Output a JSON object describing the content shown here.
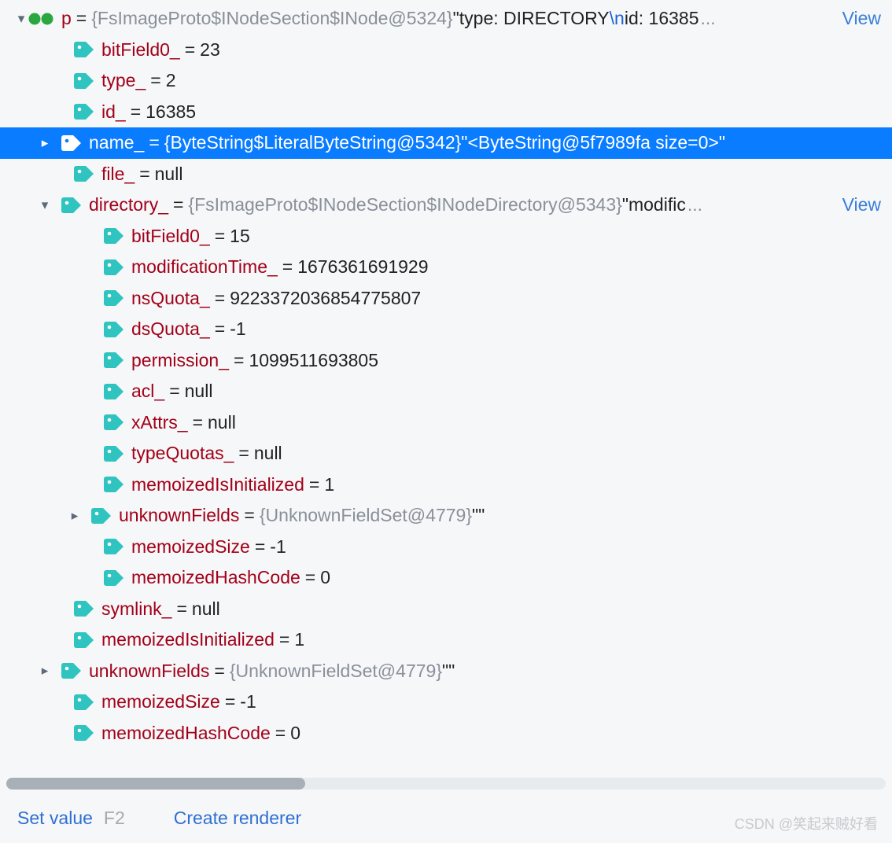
{
  "root": {
    "name": "p",
    "eq": " = ",
    "type": "{FsImageProto$INodeSection$INode@5324}",
    "str1": " \"type: DIRECTORY",
    "nl": "\\n",
    "str2": "id: 16385",
    "view": "View",
    "ell": "..."
  },
  "c": {
    "bf0": {
      "name": "bitField0_",
      "eq": " = ",
      "val": "23"
    },
    "type": {
      "name": "type_",
      "eq": " = ",
      "val": "2"
    },
    "id": {
      "name": "id_",
      "eq": " = ",
      "val": "16385"
    },
    "nameRow": {
      "name": "name_",
      "eq": " = ",
      "type": "{ByteString$LiteralByteString@5342}",
      "str": " \"<ByteString@5f7989fa size=0>\""
    },
    "file": {
      "name": "file_",
      "eq": " = ",
      "val": "null"
    },
    "dir": {
      "name": "directory_",
      "eq": " = ",
      "type": "{FsImageProto$INodeSection$INodeDirectory@5343}",
      "str": " \"modific",
      "ell": "...",
      "view": "View"
    },
    "symlink": {
      "name": "symlink_",
      "eq": " = ",
      "val": "null"
    },
    "mii": {
      "name": "memoizedIsInitialized",
      "eq": " = ",
      "val": "1"
    },
    "uf": {
      "name": "unknownFields",
      "eq": " = ",
      "type": "{UnknownFieldSet@4779}",
      "str": " \"\""
    },
    "msz": {
      "name": "memoizedSize",
      "eq": " = ",
      "val": "-1"
    },
    "mhc": {
      "name": "memoizedHashCode",
      "eq": " = ",
      "val": "0"
    }
  },
  "d": {
    "bf0": {
      "name": "bitField0_",
      "eq": " = ",
      "val": "15"
    },
    "mtime": {
      "name": "modificationTime_",
      "eq": " = ",
      "val": "1676361691929"
    },
    "nsq": {
      "name": "nsQuota_",
      "eq": " = ",
      "val": "9223372036854775807"
    },
    "dsq": {
      "name": "dsQuota_",
      "eq": " = ",
      "val": "-1"
    },
    "perm": {
      "name": "permission_",
      "eq": " = ",
      "val": "1099511693805"
    },
    "acl": {
      "name": "acl_",
      "eq": " = ",
      "val": "null"
    },
    "xattr": {
      "name": "xAttrs_",
      "eq": " = ",
      "val": "null"
    },
    "tq": {
      "name": "typeQuotas_",
      "eq": " = ",
      "val": "null"
    },
    "mii": {
      "name": "memoizedIsInitialized",
      "eq": " = ",
      "val": "1"
    },
    "uf": {
      "name": "unknownFields",
      "eq": " = ",
      "type": "{UnknownFieldSet@4779}",
      "str": " \"\""
    },
    "msz": {
      "name": "memoizedSize",
      "eq": " = ",
      "val": "-1"
    },
    "mhc": {
      "name": "memoizedHashCode",
      "eq": " = ",
      "val": "0"
    }
  },
  "footer": {
    "setValue": "Set value",
    "shortcut": "F2",
    "create": "Create renderer"
  },
  "watermark": "CSDN @笑起来贼好看"
}
